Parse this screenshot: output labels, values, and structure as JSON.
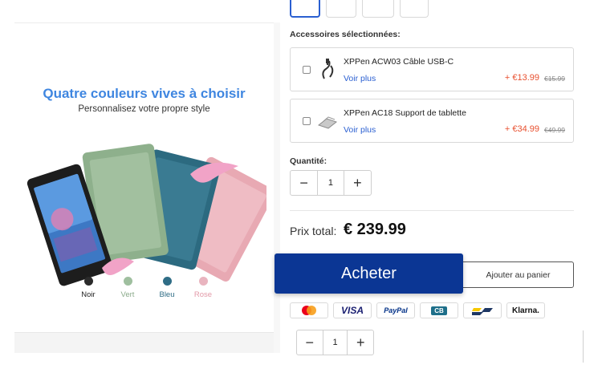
{
  "promo": {
    "title": "Quatre couleurs vives à choisir",
    "subtitle": "Personnalisez votre propre style",
    "colors": [
      {
        "label": "Noir",
        "dot": "#2b2b2b",
        "text": "#222222"
      },
      {
        "label": "Vert",
        "dot": "#9fbf9f",
        "text": "#8aaa8a"
      },
      {
        "label": "Bleu",
        "dot": "#2f6d86",
        "text": "#2f6d86"
      },
      {
        "label": "Rose",
        "dot": "#e9b4bf",
        "text": "#e39aa8"
      }
    ]
  },
  "accessories": {
    "heading": "Accessoires sélectionnées:",
    "items": [
      {
        "name": "XPPen ACW03 Câble USB-C",
        "link": "Voir plus",
        "price": "+ €13.99",
        "old_price": "€15.99",
        "icon": "usb-cable-icon"
      },
      {
        "name": "XPPen AC18 Support de tablette",
        "link": "Voir plus",
        "price": "+ €34.99",
        "old_price": "€49.99",
        "icon": "tablet-stand-icon"
      }
    ]
  },
  "quantity": {
    "label": "Quantité:",
    "value": "1",
    "minus": "−",
    "plus": "+"
  },
  "total": {
    "label": "Prix total:",
    "value": "€ 239.99"
  },
  "actions": {
    "buy": "Acheter",
    "add_to_cart": "Ajouter au panier"
  },
  "payments": [
    "mastercard-icon",
    "VISA",
    "PayPal",
    "CB",
    "bancontact-icon",
    "Klarna."
  ],
  "sticky_quantity": {
    "value": "1",
    "minus": "−",
    "plus": "+"
  },
  "accent": "#0b3694",
  "price_color": "#e8502f",
  "link_color": "#2a5fd1"
}
